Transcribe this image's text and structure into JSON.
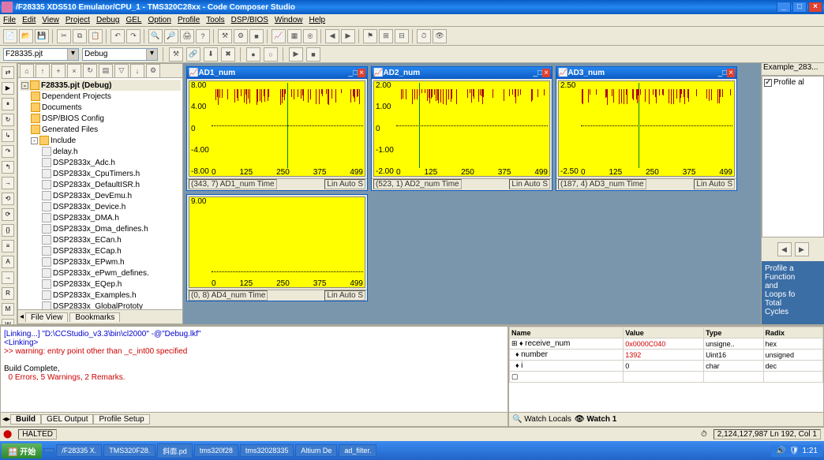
{
  "title": "/F28335 XDS510 Emulator/CPU_1 - TMS320C28xx - Code Composer Studio",
  "menu": [
    "File",
    "Edit",
    "View",
    "Project",
    "Debug",
    "GEL",
    "Option",
    "Profile",
    "Tools",
    "DSP/BIOS",
    "Window",
    "Help"
  ],
  "combo1": "F28335.pjt",
  "combo2": "Debug",
  "tree": {
    "root": "F28335.pjt (Debug)",
    "folders": [
      "Dependent Projects",
      "Documents",
      "DSP/BIOS Config",
      "Generated Files",
      "Include"
    ],
    "files": [
      "delay.h",
      "DSP2833x_Adc.h",
      "DSP2833x_CpuTimers.h",
      "DSP2833x_DefaultISR.h",
      "DSP2833x_DevEmu.h",
      "DSP2833x_Device.h",
      "DSP2833x_DMA.h",
      "DSP2833x_Dma_defines.h",
      "DSP2833x_ECan.h",
      "DSP2833x_ECap.h",
      "DSP2833x_EPwm.h",
      "DSP2833x_ePwm_defines.",
      "DSP2833x_EQep.h",
      "DSP2833x_Examples.h",
      "DSP2833x_GlobalPrototy"
    ]
  },
  "tree_tabs": [
    "File View",
    "Bookmarks"
  ],
  "charts": [
    {
      "title": "AD1_num",
      "status_l": "(343, 7)  AD1_num    Time",
      "status_r": "Lin  Auto S"
    },
    {
      "title": "AD2_num",
      "status_l": "(523, 1)  AD2_num    Time",
      "status_r": "Lin  Auto S"
    },
    {
      "title": "AD3_num",
      "status_l": "(187, 4)  AD3_num    Time",
      "status_r": "Lin  Auto S"
    },
    {
      "title_hidden": "AD4_num",
      "status_l": "(0, 8)  AD4_num    Time",
      "status_r": "Lin  Auto S"
    }
  ],
  "chart_data": [
    {
      "type": "line",
      "title": "AD1_num",
      "xlabel": "Time",
      "y_ticks": [
        "8.00",
        "4.00",
        "0",
        "-4.00",
        "-8.00"
      ],
      "x_ticks": [
        "0",
        "125",
        "250",
        "375",
        "499"
      ],
      "ylim": [
        -8,
        8
      ],
      "xlim": [
        0,
        499
      ]
    },
    {
      "type": "line",
      "title": "AD2_num",
      "xlabel": "Time",
      "y_ticks": [
        "2.00",
        "1.00",
        "0",
        "-1.00",
        "-2.00"
      ],
      "x_ticks": [
        "0",
        "125",
        "250",
        "375",
        "499"
      ],
      "ylim": [
        -2,
        2
      ],
      "xlim": [
        0,
        499
      ]
    },
    {
      "type": "line",
      "title": "AD3_num",
      "xlabel": "Time",
      "y_ticks": [
        "2.50",
        "-2.50"
      ],
      "x_ticks": [
        "0",
        "125",
        "250",
        "375",
        "499"
      ],
      "ylim": [
        -2.5,
        2.5
      ],
      "xlim": [
        0,
        499
      ]
    },
    {
      "type": "line",
      "title": "AD4_num",
      "xlabel": "Time",
      "y_ticks": [
        "9.00"
      ],
      "x_ticks": [
        "0",
        "125",
        "250",
        "375",
        "499"
      ],
      "ylim": [
        0,
        9
      ],
      "xlim": [
        0,
        499
      ]
    }
  ],
  "right_top_file": "Example_283...",
  "right_chk": "Profile al",
  "right_panel": "Profile a\nFunction\nand\nLoops fo\nTotal\nCycles",
  "console": {
    "line1": "[Linking...] \"D:\\CCStudio_v3.3\\bin\\cl2000\" -@\"Debug.lkf\"",
    "line2": "<Linking>",
    "line3": ">> warning: entry point other than _c_int00 specified",
    "line4": "",
    "line5": "Build Complete,",
    "line6": "  0 Errors, 5 Warnings, 2 Remarks."
  },
  "console_tabs": [
    "Build",
    "GEL Output",
    "Profile Setup"
  ],
  "watch": {
    "headers": [
      "Name",
      "Value",
      "Type",
      "Radix"
    ],
    "rows": [
      {
        "name": "receive_num",
        "value": "0x0000C040",
        "type": "unsigne..",
        "radix": "hex"
      },
      {
        "name": "number",
        "value": "1392",
        "type": "Uint16",
        "radix": "unsigned"
      },
      {
        "name": "i",
        "value": "0",
        "type": "char",
        "radix": "dec"
      }
    ]
  },
  "watch_tabs": [
    "Watch Locals",
    "Watch 1"
  ],
  "status_halted": "HALTED",
  "status_pos": "2,124,127,987 Ln 192, Col 1",
  "taskbar": {
    "start": "开始",
    "items": [
      "",
      "/F28335 X.",
      "TMS320F28.",
      "斜面.pd",
      "tms320f28",
      "tms32028335",
      "Altium De",
      "ad_filter."
    ],
    "time": "1:21"
  }
}
